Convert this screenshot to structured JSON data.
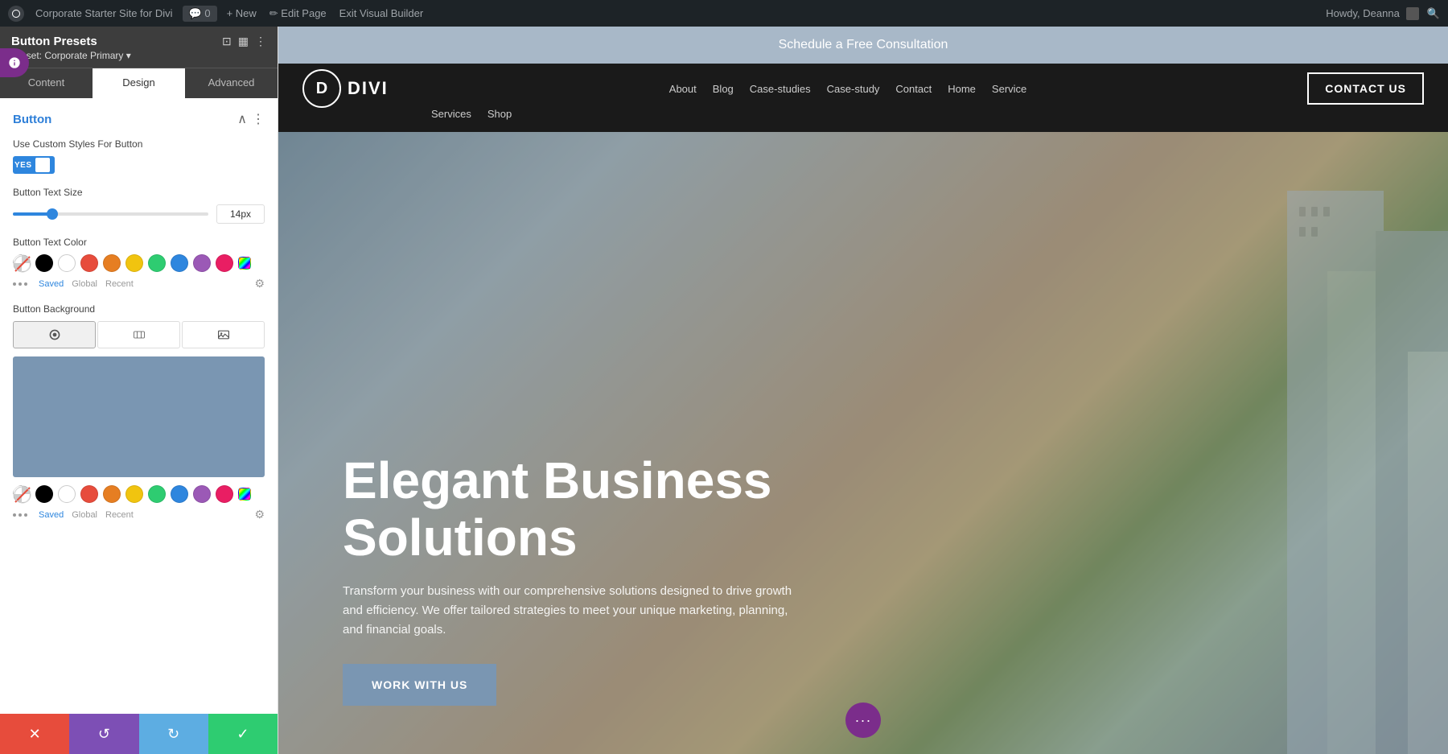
{
  "admin_bar": {
    "wp_label": "W",
    "site_name": "Corporate Starter Site for Divi",
    "comment_count": "0",
    "new_label": "+ New",
    "edit_page_label": "✏ Edit Page",
    "exit_vb_label": "Exit Visual Builder",
    "howdy_label": "Howdy, Deanna"
  },
  "panel": {
    "title": "Button Presets",
    "preset_label": "Preset:",
    "preset_value": "Corporate Primary ▾",
    "icons": [
      "⊡",
      "▦",
      "⋮"
    ],
    "tabs": [
      {
        "label": "Content",
        "active": false
      },
      {
        "label": "Design",
        "active": true
      },
      {
        "label": "Advanced",
        "active": false
      }
    ],
    "section_title": "Button",
    "custom_styles_label": "Use Custom Styles For Button",
    "toggle_yes": "YES",
    "text_size_label": "Button Text Size",
    "text_size_value": "14px",
    "text_color_label": "Button Text Color",
    "color_swatches": [
      "transparent",
      "#000000",
      "#ffffff",
      "#e74c3c",
      "#e67e22",
      "#f1c40f",
      "#2ecc71",
      "#2e86de",
      "#9b59b6",
      "#e91e63"
    ],
    "swatch_tabs": [
      "Saved",
      "Global",
      "Recent"
    ],
    "bg_label": "Button Background",
    "bg_tabs": [
      "color",
      "gradient",
      "image"
    ],
    "footer_buttons": [
      "cancel",
      "undo",
      "redo",
      "save"
    ]
  },
  "website": {
    "schedule_bar": "Schedule a Free Consultation",
    "nav": {
      "logo_letter": "D",
      "logo_text": "DIVI",
      "links": [
        "About",
        "Blog",
        "Case-studies",
        "Case-study",
        "Contact",
        "Home",
        "Service"
      ],
      "contact_btn": "CONTACT US",
      "sub_links": [
        "Services",
        "Shop"
      ]
    },
    "hero": {
      "title": "Elegant Business Solutions",
      "subtitle": "Transform your business with our comprehensive solutions designed to drive growth and efficiency. We offer tailored strategies to meet your unique marketing, planning, and financial goals.",
      "cta_label": "WORK WITH US"
    }
  }
}
